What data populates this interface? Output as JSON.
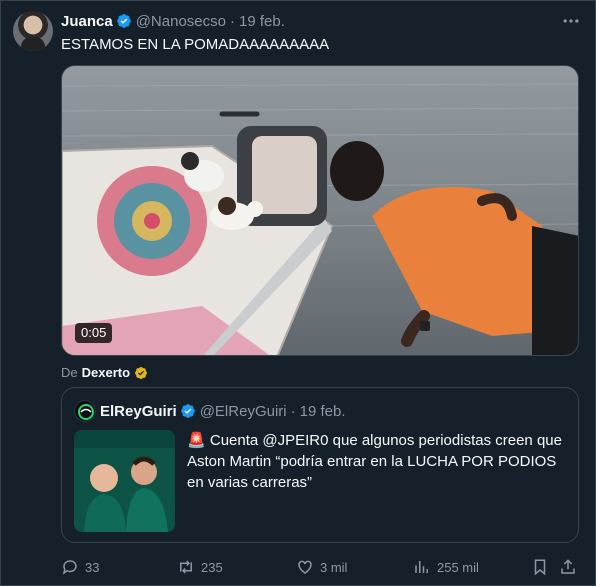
{
  "tweet": {
    "author_name": "Juanca",
    "handle": "@Nanosecso",
    "separator": "·",
    "date": "19 feb.",
    "text": "ESTAMOS EN LA POMADAAAAAAAAA",
    "video_duration": "0:05",
    "source_prefix": "De",
    "source_name": "Dexerto"
  },
  "quote": {
    "author_name": "ElReyGuiri",
    "handle": "@ElReyGuiri",
    "separator": "·",
    "date": "19 feb.",
    "emoji": "🚨",
    "text": "Cuenta @JPEIR0 que algunos periodistas creen que Aston Martin “podría entrar en la LUCHA POR PODIOS en varias carreras”"
  },
  "actions": {
    "replies": "33",
    "retweets": "235",
    "likes": "3 mil",
    "views": "255 mil"
  },
  "colors": {
    "background": "#15202b",
    "border": "#38444d",
    "muted": "#8b98a5",
    "verified_blue": "#1d9bf0",
    "verified_gold": "#e2b719"
  }
}
